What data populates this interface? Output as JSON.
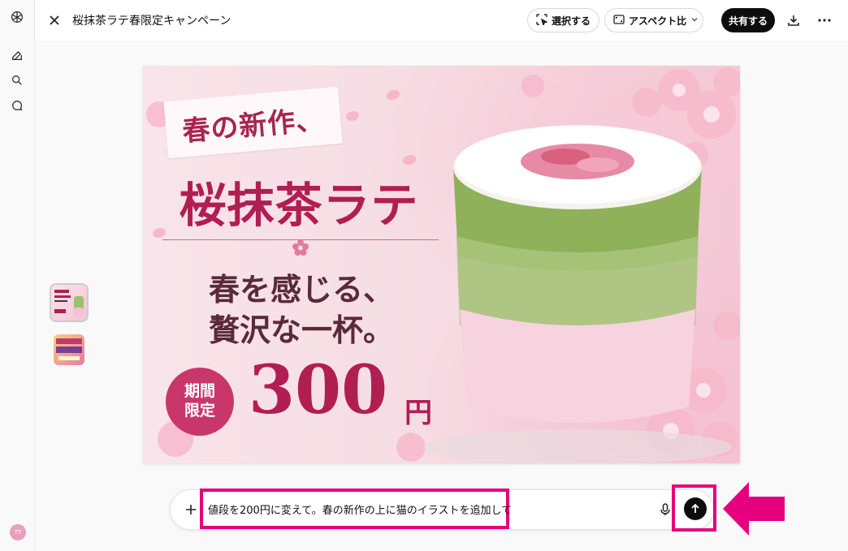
{
  "app": {
    "title": "桜抹茶ラテ春限定キャンペーン",
    "user_initials": "TT"
  },
  "toolbar": {
    "select_label": "選択する",
    "aspect_label": "アスペクト比",
    "share_label": "共有する"
  },
  "poster": {
    "banner_text": "春の新作、",
    "headline": "桜抹茶ラテ",
    "sub_line1": "春を感じる、",
    "sub_line2": "贅沢な一杯。",
    "badge_line1": "期間",
    "badge_line2": "限定",
    "price": "300",
    "price_unit": "円"
  },
  "composer": {
    "prompt": "値段を200円に変えて。春の新作の上に猫のイラストを追加して"
  },
  "colors": {
    "highlight": "#e6007e",
    "brand_pink": "#b01e52",
    "dark": "#0d0d0d"
  },
  "icons": [
    "openai-logo-icon",
    "new-chat-icon",
    "search-icon",
    "chat-bubble-icon",
    "close-icon",
    "select-icon",
    "aspect-icon",
    "chevron-down-icon",
    "download-icon",
    "more-icon",
    "plus-icon",
    "mic-icon",
    "arrow-up-icon",
    "pointer-arrow-icon"
  ]
}
